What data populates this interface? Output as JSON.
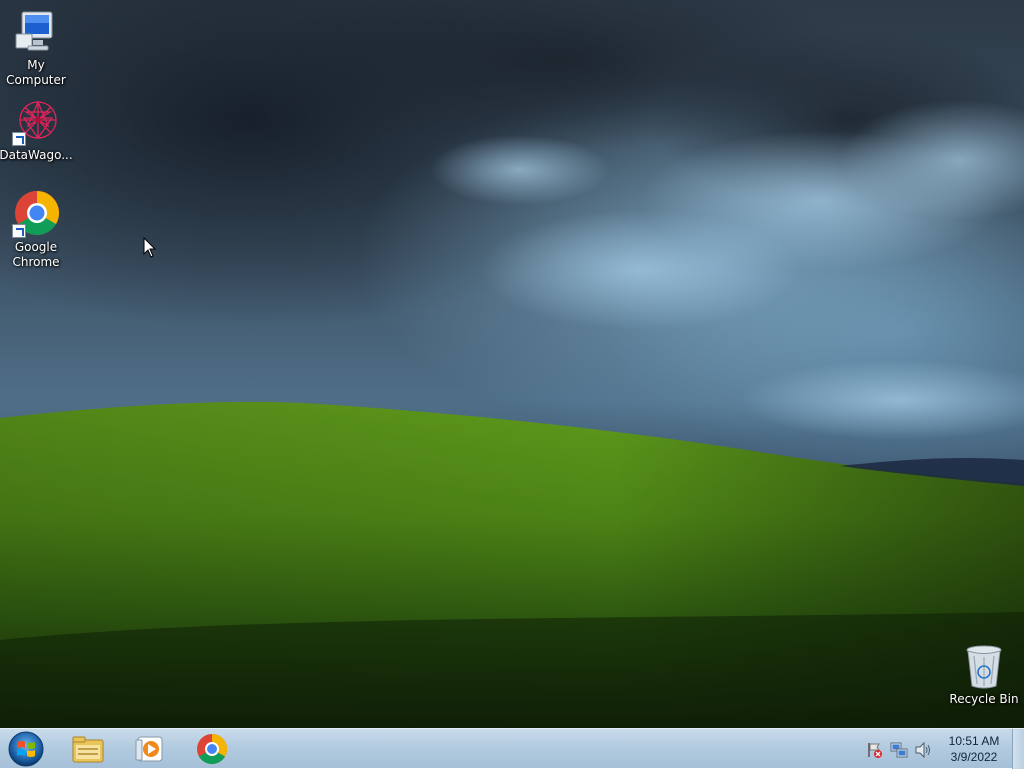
{
  "desktop": {
    "icons": [
      {
        "label_line1": "My",
        "label_line2": "Computer",
        "icon": "computer-icon"
      },
      {
        "label": "DataWago...",
        "icon": "datawagon-icon"
      },
      {
        "label_line1": "Google",
        "label_line2": "Chrome",
        "icon": "chrome-icon"
      },
      {
        "label": "Recycle Bin",
        "icon": "recycle-bin-icon"
      }
    ]
  },
  "taskbar": {
    "start_icon": "windows-logo-icon",
    "pinned": [
      {
        "icon": "file-explorer-icon"
      },
      {
        "icon": "media-player-icon"
      },
      {
        "icon": "chrome-icon"
      }
    ],
    "tray": {
      "icons": [
        "action-center-flag-icon",
        "network-icon",
        "volume-icon"
      ],
      "time": "10:51 AM",
      "date": "3/9/2022"
    }
  }
}
